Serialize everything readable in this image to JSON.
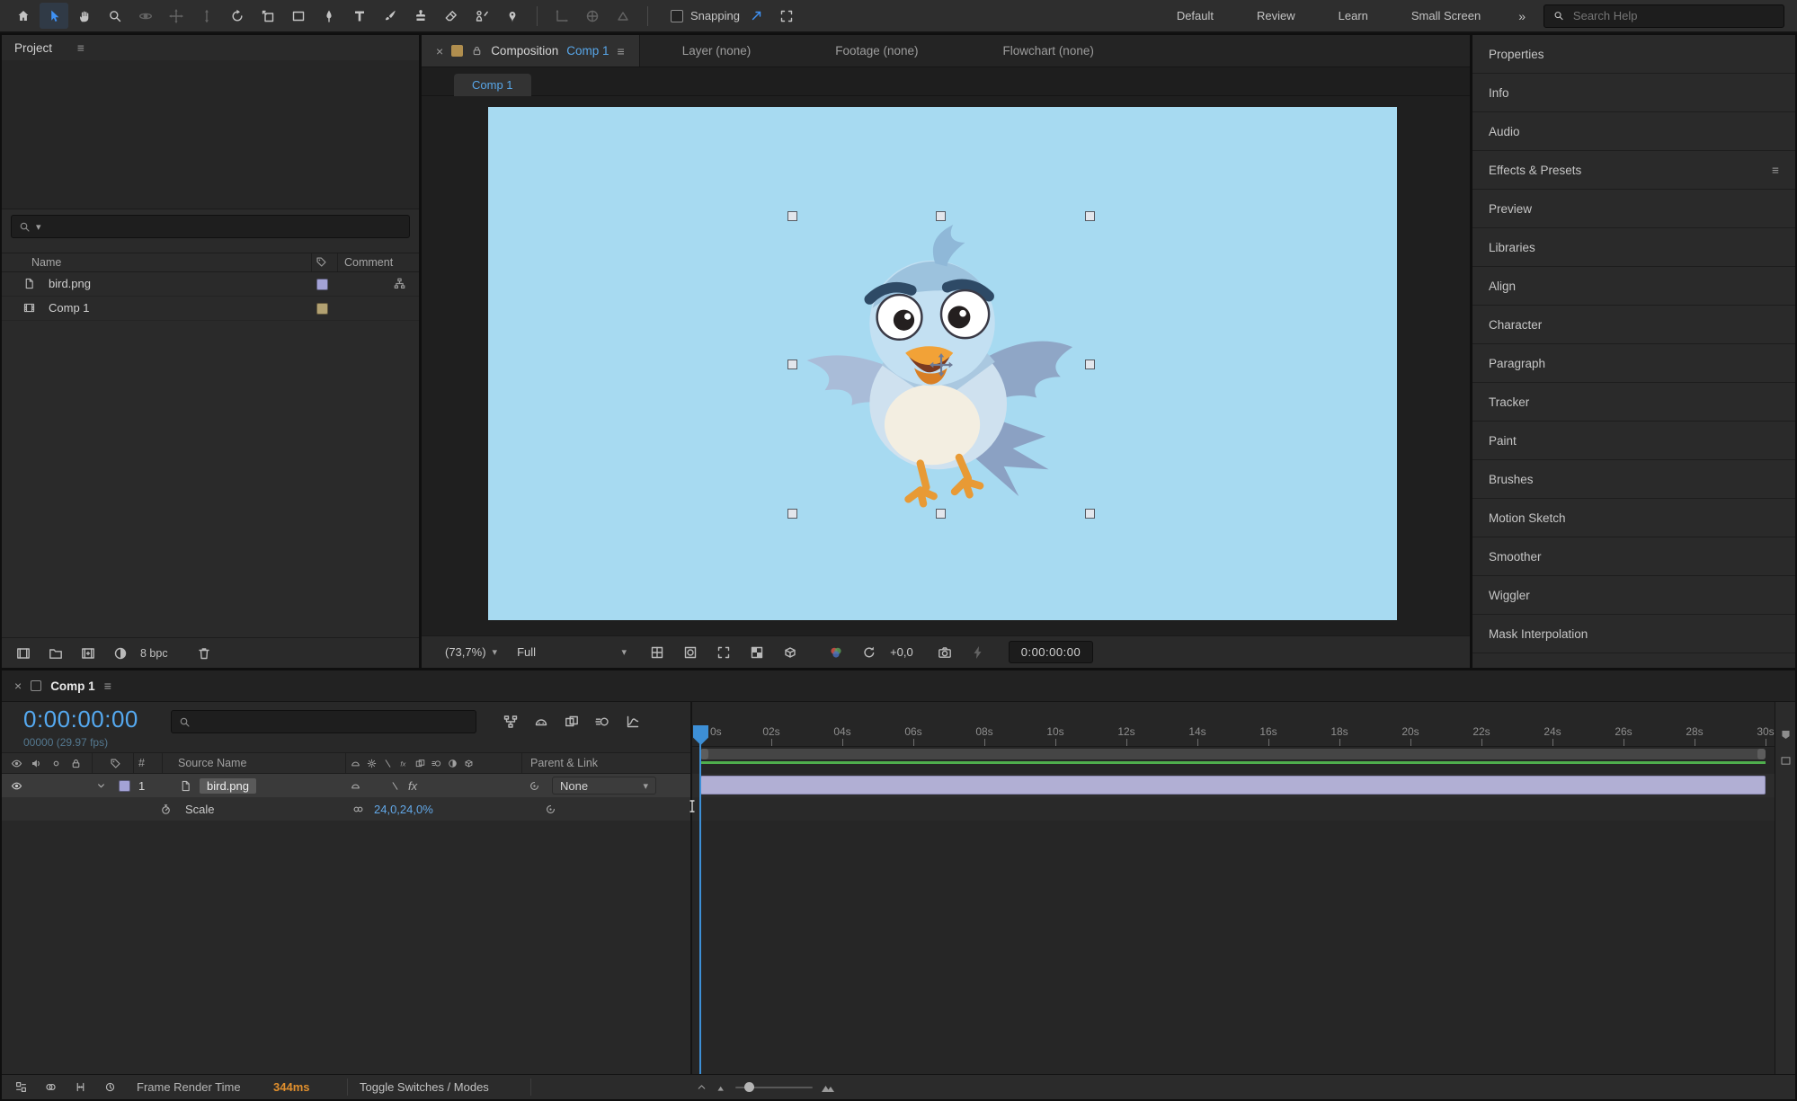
{
  "toolbar": {
    "snapping_label": "Snapping",
    "workspaces": [
      "Default",
      "Review",
      "Learn",
      "Small Screen"
    ],
    "overflow_glyph": "»",
    "help_search_placeholder": "Search Help"
  },
  "glyphs": {
    "close": "×",
    "menu": "≡",
    "dropdown": "▾",
    "fx": "fx"
  },
  "project": {
    "title": "Project",
    "columns": {
      "name": "Name",
      "comment": "Comment"
    },
    "items": [
      {
        "name": "bird.png",
        "label_color": "#a3a2d6"
      },
      {
        "name": "Comp 1",
        "label_color": "#b2a172"
      }
    ],
    "bpc_label": "8 bpc"
  },
  "composition": {
    "tab": {
      "panel": "Composition",
      "target": "Comp 1"
    },
    "other_tabs": [
      "Layer (none)",
      "Footage (none)",
      "Flowchart (none)"
    ],
    "viewer_tab": "Comp 1",
    "zoom": "(73,7%)",
    "resolution": "Full",
    "exposure": "+0,0",
    "timecode": "0:00:00:00",
    "canvas_color": "#a7daf1"
  },
  "right_dock": {
    "items": [
      "Properties",
      "Info",
      "Audio",
      "Effects & Presets",
      "Preview",
      "Libraries",
      "Align",
      "Character",
      "Paragraph",
      "Tracker",
      "Paint",
      "Brushes",
      "Motion Sketch",
      "Smoother",
      "Wiggler",
      "Mask Interpolation"
    ]
  },
  "timeline": {
    "tab": "Comp 1",
    "timecode": "0:00:00:00",
    "frame_info": "00000 (29.97 fps)",
    "columns": {
      "index": "#",
      "source_name": "Source Name",
      "parent_link": "Parent & Link"
    },
    "layer": {
      "index": "1",
      "name": "bird.png",
      "parent": "None"
    },
    "property": {
      "name": "Scale",
      "value": "24,0,24,0%"
    },
    "ruler": [
      "0s",
      "02s",
      "04s",
      "06s",
      "08s",
      "10s",
      "12s",
      "14s",
      "16s",
      "18s",
      "20s",
      "22s",
      "24s",
      "26s",
      "28s",
      "30s"
    ],
    "footer": {
      "render_label": "Frame Render Time",
      "render_value": "344ms",
      "toggle_label": "Toggle Switches / Modes"
    }
  },
  "colors": {
    "accent_blue": "#3f92f5",
    "timecode_blue": "#55a9f0",
    "value_blue": "#62a8e8",
    "render_orange": "#e08f2d",
    "cached_green": "#4fae4d",
    "layer_bar_lavender": "#b1afd4",
    "canvas_blue": "#a7daf1"
  }
}
